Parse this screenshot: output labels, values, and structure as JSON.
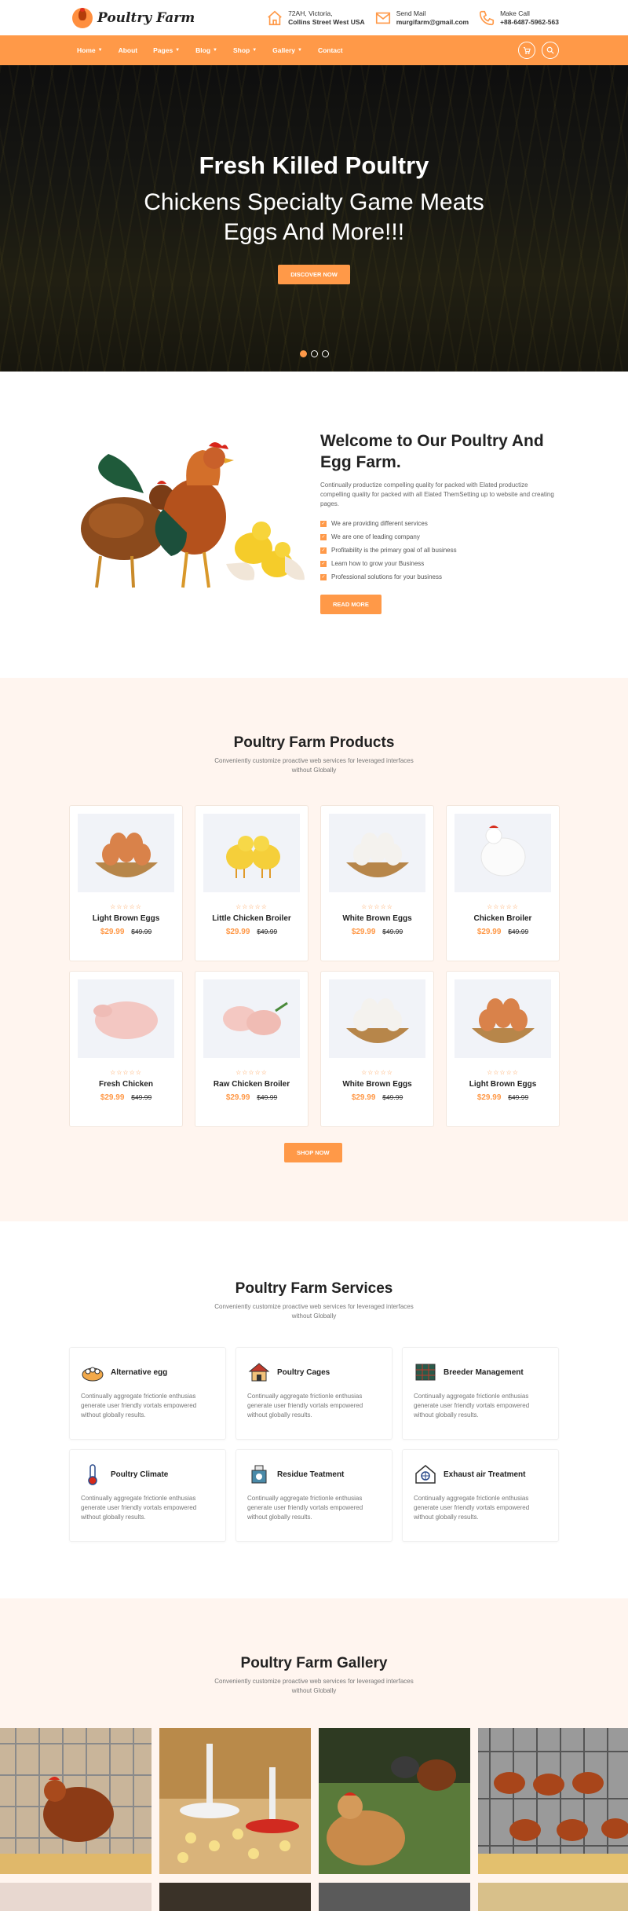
{
  "brand": {
    "name": "Poultry Farm"
  },
  "contacts": [
    {
      "icon": "home-icon",
      "line1": "72AH, Victoria,",
      "line2": "Collins Street West USA"
    },
    {
      "icon": "mail-icon",
      "line1": "Send Mail",
      "line2": "murgifarm@gmail.com"
    },
    {
      "icon": "phone-icon",
      "line1": "Make Call",
      "line2": "+88-6487-5962-563"
    }
  ],
  "nav": {
    "items": [
      {
        "label": "Home",
        "dropdown": true
      },
      {
        "label": "About",
        "dropdown": false
      },
      {
        "label": "Pages",
        "dropdown": true
      },
      {
        "label": "Blog",
        "dropdown": true
      },
      {
        "label": "Shop",
        "dropdown": true
      },
      {
        "label": "Gallery",
        "dropdown": true
      },
      {
        "label": "Contact",
        "dropdown": false
      }
    ],
    "tools": [
      "cart-icon",
      "search-icon"
    ]
  },
  "hero": {
    "title": "Fresh Killed Poultry",
    "subtitle_line1": "Chickens Specialty Game Meats",
    "subtitle_line2": "Eggs And More!!!",
    "button": "DISCOVER NOW",
    "slides": 3,
    "active_slide": 1
  },
  "welcome": {
    "title": "Welcome to Our Poultry And Egg Farm.",
    "paragraph": "Continually productize compelling quality for packed with Elated productize compelling quality for packed with all Elated ThemSetting up to website and creating pages.",
    "points": [
      "We are providing different services",
      "We are one of leading company",
      "Profitability is the primary goal of all business",
      "Learn how to grow your Business",
      "Professional solutions for your business"
    ],
    "button": "READ MORE"
  },
  "products": {
    "title": "Poultry Farm Products",
    "subtitle": "Conveniently customize proactive web services for leveraged interfaces without Globally",
    "items": [
      {
        "name": "Light Brown Eggs",
        "price": "$29.99",
        "old_price": "$49.99",
        "image": "brown-eggs"
      },
      {
        "name": "Little Chicken Broiler",
        "price": "$29.99",
        "old_price": "$49.99",
        "image": "chicks"
      },
      {
        "name": "White Brown Eggs",
        "price": "$29.99",
        "old_price": "$49.99",
        "image": "white-eggs"
      },
      {
        "name": "Chicken Broiler",
        "price": "$29.99",
        "old_price": "$49.99",
        "image": "white-hen"
      },
      {
        "name": "Fresh Chicken",
        "price": "$29.99",
        "old_price": "$49.99",
        "image": "raw-chicken"
      },
      {
        "name": "Raw Chicken Broiler",
        "price": "$29.99",
        "old_price": "$49.99",
        "image": "chicken-legs"
      },
      {
        "name": "White Brown Eggs",
        "price": "$29.99",
        "old_price": "$49.99",
        "image": "white-eggs"
      },
      {
        "name": "Light Brown Eggs",
        "price": "$29.99",
        "old_price": "$49.99",
        "image": "brown-eggs"
      }
    ],
    "stars": "☆☆☆☆☆",
    "button": "SHOP NOW"
  },
  "services": {
    "title": "Poultry Farm Services",
    "subtitle": "Conveniently customize proactive web services for leveraged interfaces without Globally",
    "items": [
      {
        "title": "Alternative egg",
        "icon": "egg-tray-icon",
        "desc": "Continually aggregate frictionle enthusias generate user friendly vortals empowered without globally results."
      },
      {
        "title": "Poultry Cages",
        "icon": "coop-icon",
        "desc": "Continually aggregate frictionle enthusias generate user friendly vortals empowered without globally results."
      },
      {
        "title": "Breeder Management",
        "icon": "breeder-icon",
        "desc": "Continually aggregate frictionle enthusias generate user friendly vortals empowered without globally results."
      },
      {
        "title": "Poultry Climate",
        "icon": "thermometer-icon",
        "desc": "Continually aggregate frictionle enthusias generate user friendly vortals empowered without globally results."
      },
      {
        "title": "Residue Teatment",
        "icon": "residue-icon",
        "desc": "Continually aggregate frictionle enthusias generate user friendly vortals empowered without globally results."
      },
      {
        "title": "Exhaust air Treatment",
        "icon": "exhaust-icon",
        "desc": "Continually aggregate frictionle enthusias generate user friendly vortals empowered without globally results."
      }
    ]
  },
  "gallery": {
    "title": "Poultry Farm Gallery",
    "subtitle": "Conveniently customize proactive web services for leveraged interfaces without Globally"
  }
}
